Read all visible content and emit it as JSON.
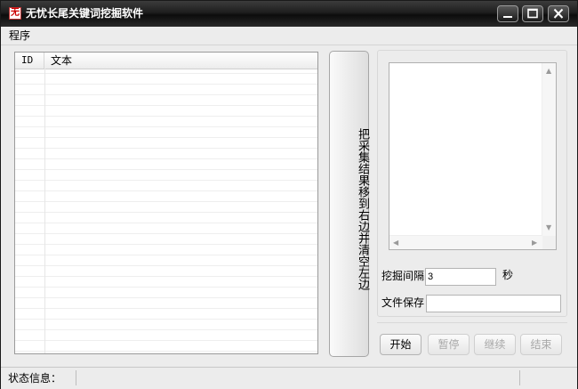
{
  "window": {
    "title": "无忧长尾关键词挖掘软件",
    "app_icon_text": "无",
    "controls": [
      "minimize-icon",
      "maximize-icon",
      "close-icon"
    ]
  },
  "menu": {
    "items": [
      "程序"
    ]
  },
  "list": {
    "columns": [
      "ID",
      "文本"
    ],
    "rows": []
  },
  "move_button_label": "把采集结果移到右边并清空左边",
  "right_panel": {
    "textarea_value": "",
    "interval_label": "挖掘间隔",
    "interval_value": "3",
    "interval_unit": "秒",
    "save_label": "文件保存",
    "save_value": ""
  },
  "buttons": {
    "start": "开始",
    "pause": "暂停",
    "resume": "继续",
    "stop": "结束"
  },
  "status": {
    "label": "状态信息："
  }
}
